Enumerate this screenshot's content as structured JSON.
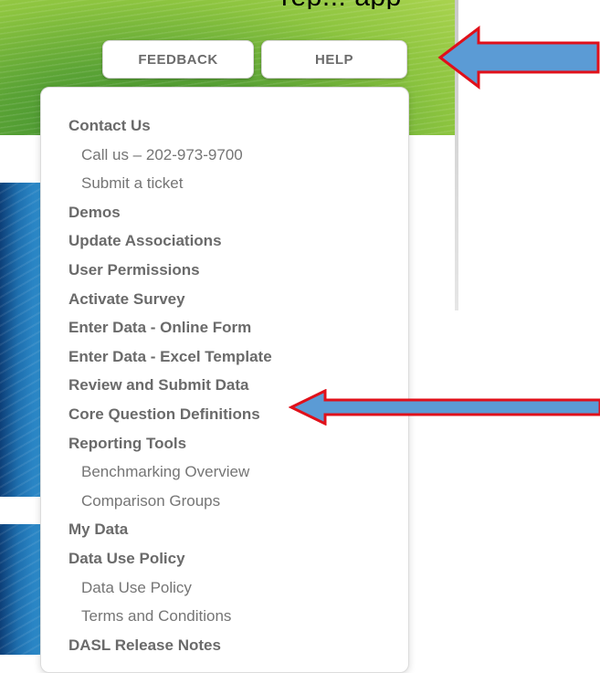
{
  "header": {
    "clipped_text": "rep... app"
  },
  "buttons": {
    "feedback_label": "FEEDBACK",
    "help_label": "HELP"
  },
  "menu": {
    "items": [
      {
        "label": "Contact Us",
        "level": "top"
      },
      {
        "label": "Call us – 202-973-9700",
        "level": "sub"
      },
      {
        "label": "Submit a ticket",
        "level": "sub"
      },
      {
        "label": "Demos",
        "level": "top"
      },
      {
        "label": "Update Associations",
        "level": "top"
      },
      {
        "label": "User Permissions",
        "level": "top"
      },
      {
        "label": "Activate Survey",
        "level": "top"
      },
      {
        "label": "Enter Data - Online Form",
        "level": "top"
      },
      {
        "label": "Enter Data - Excel Template",
        "level": "top"
      },
      {
        "label": "Review and Submit Data",
        "level": "top"
      },
      {
        "label": "Core Question Definitions",
        "level": "top"
      },
      {
        "label": "Reporting Tools",
        "level": "top"
      },
      {
        "label": "Benchmarking Overview",
        "level": "sub"
      },
      {
        "label": "Comparison Groups",
        "level": "sub"
      },
      {
        "label": "My Data",
        "level": "top"
      },
      {
        "label": "Data Use Policy",
        "level": "top"
      },
      {
        "label": "Data Use Policy",
        "level": "sub"
      },
      {
        "label": "Terms and Conditions",
        "level": "sub"
      },
      {
        "label": "DASL Release Notes",
        "level": "top"
      }
    ]
  },
  "annotations": {
    "arrow_color": "#5b9bd5",
    "arrow_outline": "#e0101a"
  }
}
